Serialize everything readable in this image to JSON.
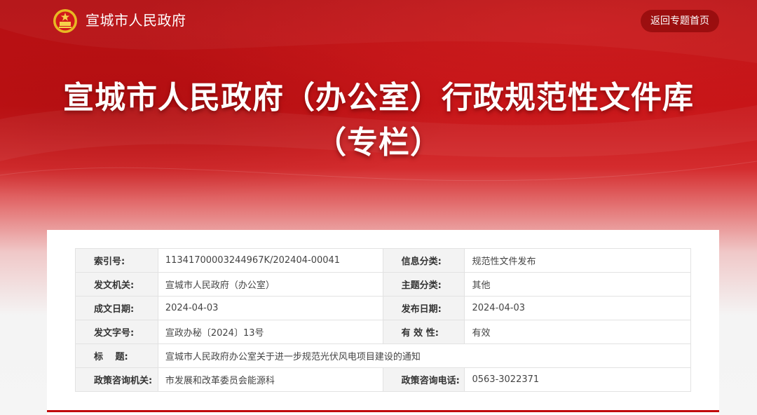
{
  "header": {
    "site_name": "宣城市人民政府",
    "back_label": "返回专题首页"
  },
  "hero": {
    "title_line1": "宣城市人民政府（办公室）行政规范性文件库",
    "title_line2": "（专栏）"
  },
  "meta": {
    "index_label": "索引号:",
    "index_value": "11341700003244967K/202404-00041",
    "category_label": "信息分类:",
    "category_value": "规范性文件发布",
    "issuer_label": "发文机关:",
    "issuer_value": "宣城市人民政府（办公室）",
    "topic_label": "主题分类:",
    "topic_value": "其他",
    "created_label": "成文日期:",
    "created_value": "2024-04-03",
    "published_label": "发布日期:",
    "published_value": "2024-04-03",
    "docno_label": "发文字号:",
    "docno_value": "宣政办秘〔2024〕13号",
    "validity_label": "有 效 性:",
    "validity_value": "有效",
    "subject_label": "标　 题:",
    "subject_value": "宣城市人民政府办公室关于进一步规范光伏风电项目建设的通知",
    "contact_org_label": "政策咨询机关:",
    "contact_org_value": "市发展和改革委员会能源科",
    "contact_phone_label": "政策咨询电话:",
    "contact_phone_value": "0563-3022371"
  },
  "colors": {
    "brand_red": "#c51316",
    "accent_red": "#c0080b"
  }
}
